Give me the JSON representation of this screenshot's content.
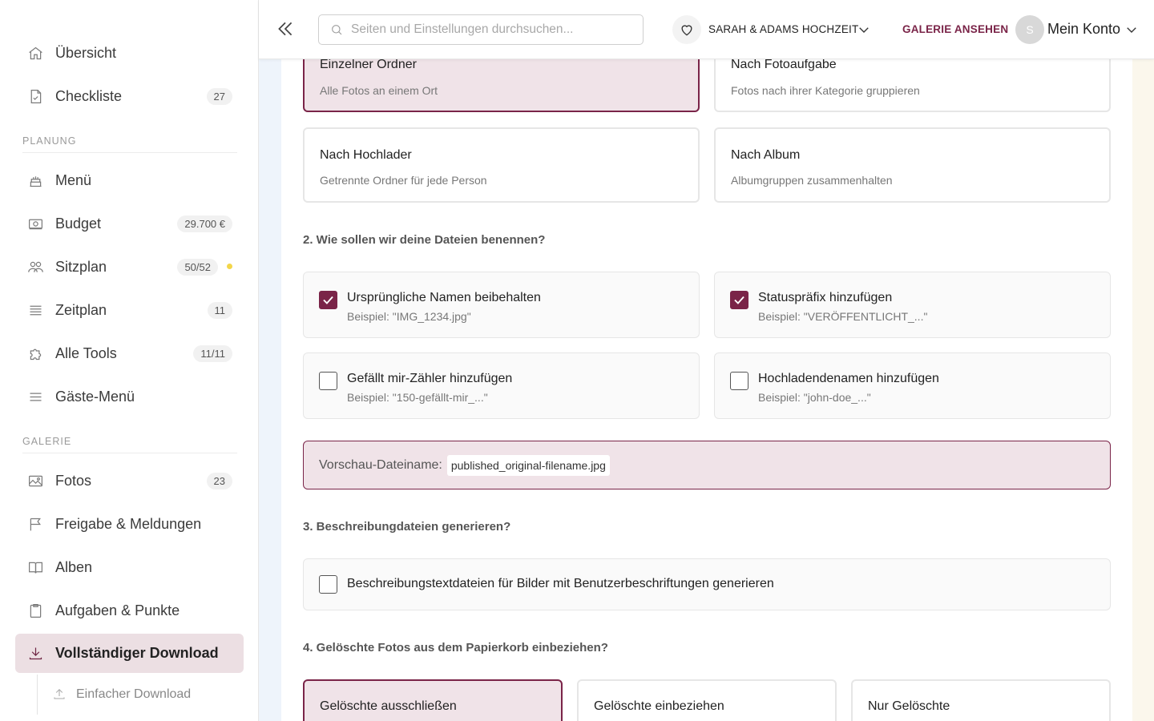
{
  "sidebar": {
    "items": [
      {
        "label": "Übersicht",
        "icon": "home-icon"
      },
      {
        "label": "Checkliste",
        "badge": "27",
        "icon": "document-check-icon"
      },
      {
        "label": "Menü",
        "icon": "cake-icon"
      },
      {
        "label": "Budget",
        "badge": "29.700 €",
        "icon": "banknote-icon"
      },
      {
        "label": "Sitzplan",
        "badge": "50/52",
        "icon": "users-icon",
        "dot_color": "#f3d64a"
      },
      {
        "label": "Zeitplan",
        "badge": "11",
        "icon": "list-icon"
      },
      {
        "label": "Alle Tools",
        "badge": "11/11",
        "icon": "puzzle-icon"
      },
      {
        "label": "Gäste-Menü",
        "icon": "menu-icon"
      },
      {
        "label": "Fotos",
        "badge": "23",
        "icon": "image-icon"
      },
      {
        "label": "Freigabe & Meldungen",
        "icon": "flag-icon"
      },
      {
        "label": "Alben",
        "icon": "book-icon"
      },
      {
        "label": "Aufgaben & Punkte",
        "icon": "clipboard-icon"
      },
      {
        "label": "Vollständiger Download",
        "icon": "download-icon",
        "active": true
      }
    ],
    "sections": {
      "planning": "PLANUNG",
      "gallery": "GALERIE"
    },
    "sub_item": {
      "label": "Einfacher Download",
      "icon": "upload-icon"
    }
  },
  "topbar": {
    "search_placeholder": "Seiten und Einstellungen durchsuchen...",
    "event_name": "SARAH & ADAMS HOCHZEIT",
    "gallery_link": "GALERIE ANSEHEN",
    "avatar_initial": "S",
    "account_label": "Mein Konto"
  },
  "folder_options": [
    {
      "title": "Einzelner Ordner",
      "desc": "Alle Fotos an einem Ort",
      "selected": true
    },
    {
      "title": "Nach Fotoaufgabe",
      "desc": "Fotos nach ihrer Kategorie gruppieren",
      "selected": false
    },
    {
      "title": "Nach Hochlader",
      "desc": "Getrennte Ordner für jede Person",
      "selected": false
    },
    {
      "title": "Nach Album",
      "desc": "Albumgruppen zusammenhalten",
      "selected": false
    }
  ],
  "naming": {
    "question": "2. Wie sollen wir deine Dateien benennen?",
    "options": [
      {
        "title": "Ursprüngliche Namen beibehalten",
        "example": "Beispiel: \"IMG_1234.jpg\"",
        "checked": true
      },
      {
        "title": "Statuspräfix hinzufügen",
        "example": "Beispiel: \"VERÖFFENTLICHT_...\"",
        "checked": true
      },
      {
        "title": "Gefällt mir-Zähler hinzufügen",
        "example": "Beispiel: \"150-gefällt-mir_...\"",
        "checked": false
      },
      {
        "title": "Hochladendenamen hinzufügen",
        "example": "Beispiel: \"john-doe_...\"",
        "checked": false
      }
    ],
    "preview_label": "Vorschau-Dateiname:",
    "preview_value": "published_original-filename.jpg"
  },
  "descriptions": {
    "question": "3. Beschreibungdateien generieren?",
    "option": "Beschreibungstextdateien für Bilder mit Benutzerbeschriftungen generieren",
    "checked": false
  },
  "trash": {
    "question": "4. Gelöschte Fotos aus dem Papierkorb einbeziehen?",
    "options": [
      {
        "title": "Gelöschte ausschließen",
        "selected": true
      },
      {
        "title": "Gelöschte einbeziehen",
        "selected": false
      },
      {
        "title": "Nur Gelöschte",
        "selected": false
      }
    ]
  },
  "colors": {
    "accent": "#7a2448",
    "accent_bg": "#f0e3e8",
    "active_nav_bg": "#ecdfe3"
  }
}
